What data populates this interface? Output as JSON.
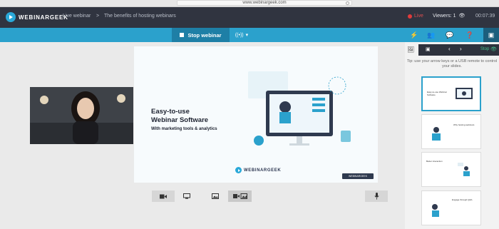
{
  "browser": {
    "url": "www.webinargeek.com"
  },
  "topbar": {
    "logo_text": "WEBINARGEEK",
    "crumb_1": "Live webinar",
    "crumb_sep": ">",
    "crumb_2": "The benefits of hosting webinars",
    "live_label": "Live",
    "viewers_label": "Viewers: 1",
    "timer": "00:07:39"
  },
  "toolbar": {
    "stop_label": "Stop webinar",
    "icons": [
      "flash-icon",
      "people-icon",
      "chat-icon",
      "questions-icon",
      "layout-icon"
    ]
  },
  "slide": {
    "title_line1": "Easy-to-use",
    "title_line2": "Webinar Software",
    "subtitle": "With marketing tools & analytics",
    "logo_text": "WEBINARGEEK",
    "badge": "WEBINARGEEK"
  },
  "controls": [
    "camera-icon",
    "screen-icon",
    "image-icon",
    "camera-image-icon",
    "mic-icon"
  ],
  "sidebar": {
    "tip": "Tip: use your arrow keys or a USB remote to control your slides.",
    "stop_label": "Stop",
    "thumbs": [
      {
        "title": "Easy-to-use Webinar Software"
      },
      {
        "title": "Why hosting webinars"
      },
      {
        "title": "Better interaction"
      },
      {
        "title": "Engage through Q&A"
      }
    ]
  },
  "colors": {
    "topbar": "#303440",
    "accent": "#2ba1cc",
    "live": "#e03b3b"
  }
}
